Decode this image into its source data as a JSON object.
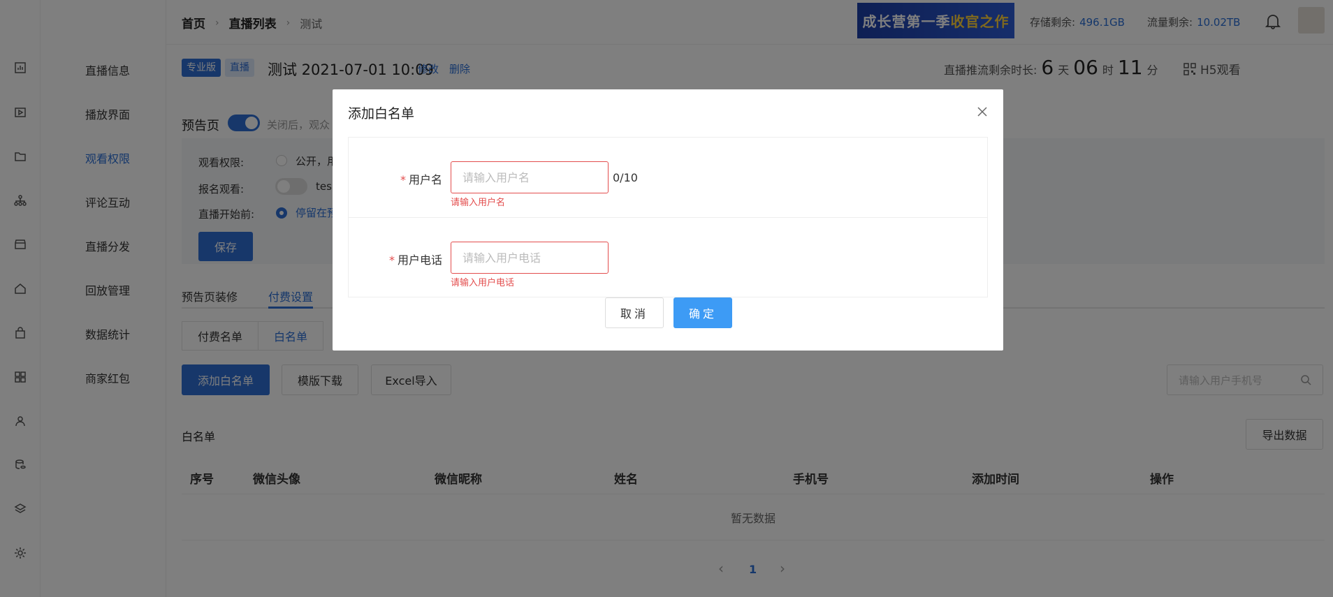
{
  "breadcrumb": {
    "home": "首页",
    "list": "直播列表",
    "current": "测试"
  },
  "banner": {
    "part1": "成长营第一季",
    "part2": "收官之作"
  },
  "stats": {
    "storage_label": "存储剩余:",
    "storage_value": "496.1GB",
    "traffic_label": "流量剩余:",
    "traffic_value": "10.02TB"
  },
  "menu": {
    "items": [
      "直播信息",
      "播放界面",
      "观看权限",
      "评论互动",
      "直播分发",
      "回放管理",
      "数据统计",
      "商家红包"
    ],
    "active_index": 2
  },
  "live": {
    "tag_pro": "专业版",
    "tag_live": "直播",
    "title": "测试 2021-07-01 10:09",
    "edit": "修改",
    "delete": "删除",
    "remain_label": "直播推流剩余时长:",
    "days": "6",
    "days_unit": "天",
    "hours": "06",
    "hours_unit": "时",
    "minutes": "11",
    "minutes_unit": "分",
    "h5": "H5观看"
  },
  "preview": {
    "label": "预告页",
    "hint": "关闭后，观众",
    "perm_label": "观看权限:",
    "perm_opt": "公开，用",
    "signup_label": "报名观看:",
    "signup_val": "tes",
    "before_label": "直播开始前:",
    "before_opt": "停留在预",
    "save": "保存"
  },
  "tabs": {
    "decorate": "预告页装修",
    "paid": "付费设置"
  },
  "subtabs": {
    "paid_list": "付费名单",
    "whitelist": "白名单"
  },
  "actions": {
    "add": "添加白名单",
    "template": "模版下载",
    "excel": "Excel导入",
    "search_placeholder": "请输入用户手机号",
    "export": "导出数据"
  },
  "table": {
    "title": "白名单",
    "columns": [
      "序号",
      "微信头像",
      "微信昵称",
      "姓名",
      "手机号",
      "添加时间",
      "操作"
    ],
    "empty": "暂无数据"
  },
  "pager": {
    "prev": "‹",
    "page": "1",
    "next": "›"
  },
  "dialog": {
    "title": "添加白名单",
    "name_label": "用户名",
    "name_placeholder": "请输入用户名",
    "name_count": "0/10",
    "name_error": "请输入用户名",
    "phone_label": "用户电话",
    "phone_placeholder": "请输入用户电话",
    "phone_error": "请输入用户电话",
    "cancel": "取消",
    "ok": "确定",
    "required_mark": "*"
  }
}
